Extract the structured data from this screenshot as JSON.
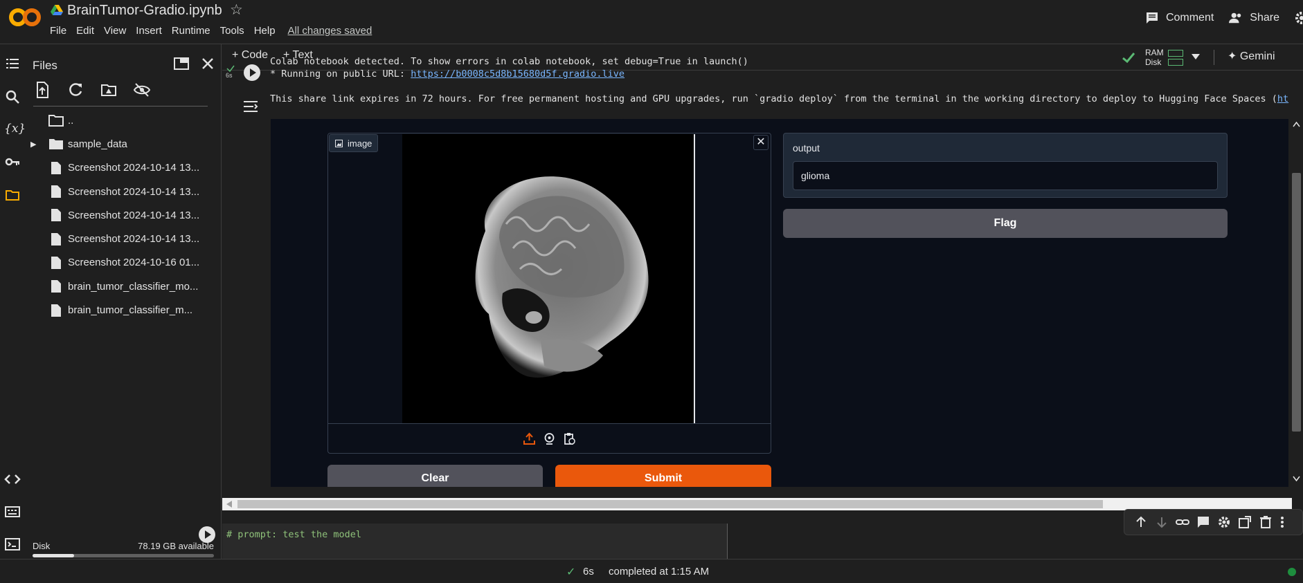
{
  "header": {
    "notebook_title": "BrainTumor-Gradio.ipynb",
    "menu": [
      "File",
      "Edit",
      "View",
      "Insert",
      "Runtime",
      "Tools",
      "Help"
    ],
    "save_status": "All changes saved",
    "comment_label": "Comment",
    "share_label": "Share"
  },
  "files_panel": {
    "title": "Files",
    "items": [
      {
        "label": "..",
        "type": "folder"
      },
      {
        "label": "sample_data",
        "type": "folder"
      },
      {
        "label": "Screenshot 2024-10-14 13...",
        "type": "file"
      },
      {
        "label": "Screenshot 2024-10-14 13...",
        "type": "file"
      },
      {
        "label": "Screenshot 2024-10-14 13...",
        "type": "file"
      },
      {
        "label": "Screenshot 2024-10-14 13...",
        "type": "file"
      },
      {
        "label": "Screenshot 2024-10-16 01...",
        "type": "file"
      },
      {
        "label": "brain_tumor_classifier_mo...",
        "type": "file"
      },
      {
        "label": "brain_tumor_classifier_m...",
        "type": "file"
      }
    ],
    "disk_label": "Disk",
    "disk_available": "78.19 GB available",
    "disk_used_fraction": 0.23
  },
  "toolbar": {
    "add_code": "+ Code",
    "add_text": "+ Text",
    "ram_label": "RAM",
    "disk_label": "Disk",
    "gemini_label": "Gemini"
  },
  "cell_output": {
    "exec_time": "6s",
    "line1": "Colab notebook detected. To show errors in colab notebook, set debug=True in launch()",
    "line2_prefix": "* Running on public URL: ",
    "public_url": "https://b0008c5d8b15680d5f.gradio.live",
    "line3": "This share link expires in 72 hours. For free permanent hosting and GPU upgrades, run `gradio deploy` from the terminal in the working directory to deploy to Hugging Face Spaces (",
    "line3_link": "ht"
  },
  "gradio": {
    "image_label": "image",
    "output_label": "output",
    "output_value": "glioma",
    "flag_label": "Flag",
    "clear_label": "Clear",
    "submit_label": "Submit"
  },
  "next_cell": {
    "code": "# prompt: test the model"
  },
  "status_bar": {
    "duration": "6s",
    "text": "completed at 1:15 AM"
  },
  "colors": {
    "accent_orange": "#ea580c",
    "link_blue": "#7ab7ff",
    "success_green": "#5bb974"
  }
}
